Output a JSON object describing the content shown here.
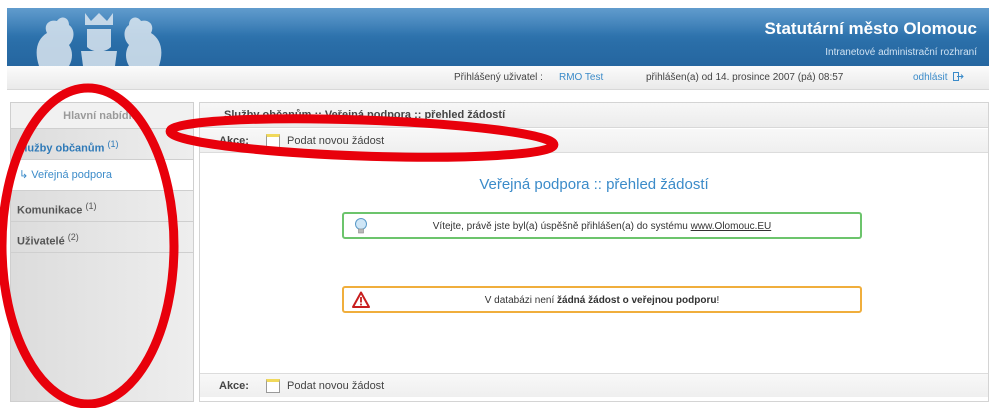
{
  "header": {
    "title": "Statutární město Olomouc",
    "subtitle": "Intranetové administrační rozhraní"
  },
  "userbar": {
    "logged_user_label": "Přihlášený uživatel :",
    "user_name": "RMO Test",
    "logged_since": "přihlášen(a) od 14. prosince 2007 (pá) 08:57",
    "logout": "odhlásit"
  },
  "sidebar": {
    "heading": "Hlavní nabídka",
    "items": [
      {
        "label": "Služby občanům",
        "count": "(1)"
      },
      {
        "label": "↳ Veřejná podpora"
      },
      {
        "label": "Komunikace",
        "count": "(1)"
      },
      {
        "label": "Uživatelé",
        "count": "(2)"
      }
    ]
  },
  "main": {
    "breadcrumb": "Služby občanům :: Veřejná podpora :: přehled žádostí",
    "actions_label": "Akce:",
    "new_request": "Podat novou žádost",
    "title": "Veřejná podpora :: přehled žádostí",
    "welcome": {
      "before": "Vítejte, právě jste byl(a) úspěšně přihlášen(a) do systému",
      "link": "www.Olomouc.EU"
    },
    "warning": {
      "before": "V databázi není",
      "bold": "žádná žádost o veřejnou podporu",
      "after": "!"
    }
  },
  "colors": {
    "header_blue": "#2a6ea8",
    "link_blue": "#3b8bc9",
    "annotation_red": "#e8000b",
    "success_border": "#6cc46c",
    "warning_border": "#f0ae3c"
  },
  "icons": [
    "coat-of-arms-logo",
    "logout-icon",
    "document-icon",
    "lightbulb-icon",
    "warning-icon"
  ]
}
